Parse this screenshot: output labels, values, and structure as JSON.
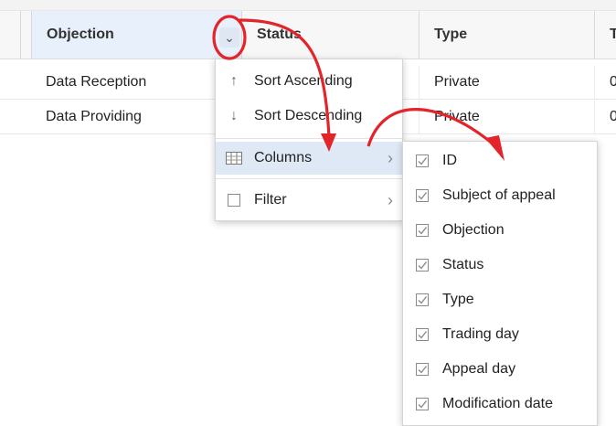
{
  "grid": {
    "columns": [
      "Objection",
      "Status",
      "Type",
      "T"
    ],
    "rows": [
      [
        "Data Reception",
        "Private",
        "0"
      ],
      [
        "Data Providing",
        "Private",
        "0"
      ]
    ],
    "menu_trigger_glyph": "⌄"
  },
  "column_menu": {
    "items": {
      "sort_asc": {
        "label": "Sort Ascending",
        "icon": "↑"
      },
      "sort_desc": {
        "label": "Sort Descending",
        "icon": "↓"
      },
      "columns": {
        "label": "Columns",
        "chevron": "›"
      },
      "filter": {
        "label": "Filter",
        "chevron": "›"
      }
    }
  },
  "columns_submenu": {
    "items": [
      "ID",
      "Subject of appeal",
      "Objection",
      "Status",
      "Type",
      "Trading day",
      "Appeal day",
      "Modification date"
    ],
    "checked": [
      true,
      true,
      true,
      true,
      true,
      true,
      true,
      true
    ]
  },
  "colors": {
    "arrow": "#e2252b",
    "highlight": "#dfe9f6"
  }
}
